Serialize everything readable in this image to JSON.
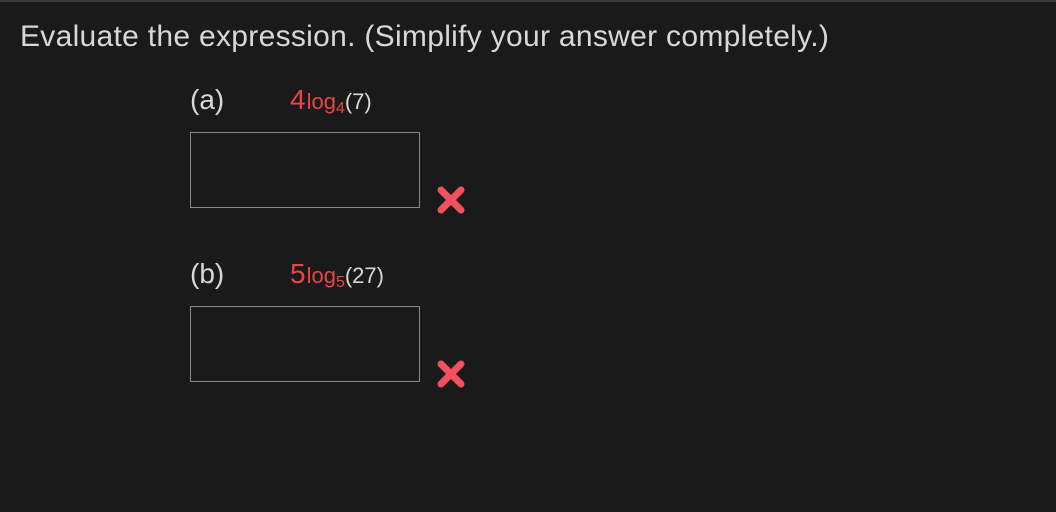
{
  "instruction": "Evaluate the expression. (Simplify your answer completely.)",
  "problems": [
    {
      "label": "(a)",
      "base": "4",
      "log_text": "log",
      "log_sub": "4",
      "arg": "(7)",
      "answer_value": "",
      "status": "incorrect"
    },
    {
      "label": "(b)",
      "base": "5",
      "log_text": "log",
      "log_sub": "5",
      "arg": "(27)",
      "answer_value": "",
      "status": "incorrect"
    }
  ]
}
